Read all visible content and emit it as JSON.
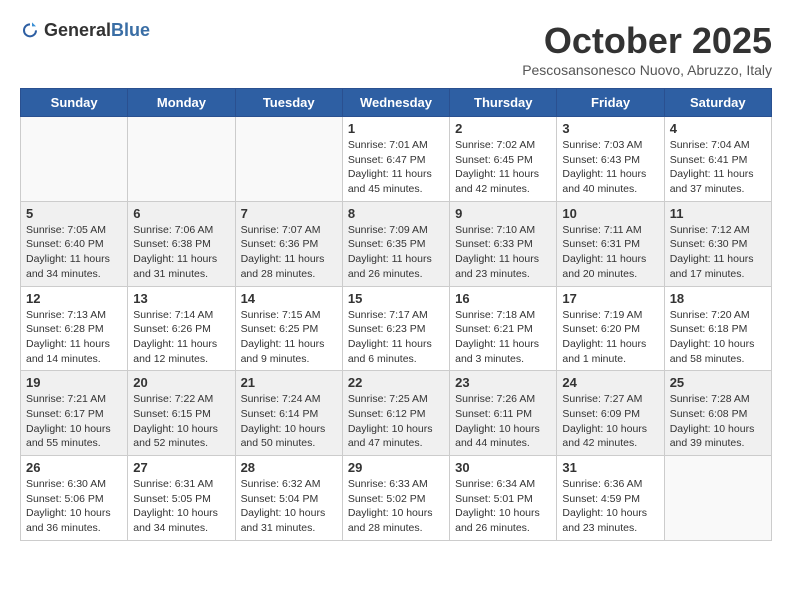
{
  "logo": {
    "general": "General",
    "blue": "Blue"
  },
  "title": "October 2025",
  "subtitle": "Pescosansonesco Nuovo, Abruzzo, Italy",
  "weekdays": [
    "Sunday",
    "Monday",
    "Tuesday",
    "Wednesday",
    "Thursday",
    "Friday",
    "Saturday"
  ],
  "weeks": [
    [
      {
        "day": "",
        "info": ""
      },
      {
        "day": "",
        "info": ""
      },
      {
        "day": "",
        "info": ""
      },
      {
        "day": "1",
        "info": "Sunrise: 7:01 AM\nSunset: 6:47 PM\nDaylight: 11 hours\nand 45 minutes."
      },
      {
        "day": "2",
        "info": "Sunrise: 7:02 AM\nSunset: 6:45 PM\nDaylight: 11 hours\nand 42 minutes."
      },
      {
        "day": "3",
        "info": "Sunrise: 7:03 AM\nSunset: 6:43 PM\nDaylight: 11 hours\nand 40 minutes."
      },
      {
        "day": "4",
        "info": "Sunrise: 7:04 AM\nSunset: 6:41 PM\nDaylight: 11 hours\nand 37 minutes."
      }
    ],
    [
      {
        "day": "5",
        "info": "Sunrise: 7:05 AM\nSunset: 6:40 PM\nDaylight: 11 hours\nand 34 minutes."
      },
      {
        "day": "6",
        "info": "Sunrise: 7:06 AM\nSunset: 6:38 PM\nDaylight: 11 hours\nand 31 minutes."
      },
      {
        "day": "7",
        "info": "Sunrise: 7:07 AM\nSunset: 6:36 PM\nDaylight: 11 hours\nand 28 minutes."
      },
      {
        "day": "8",
        "info": "Sunrise: 7:09 AM\nSunset: 6:35 PM\nDaylight: 11 hours\nand 26 minutes."
      },
      {
        "day": "9",
        "info": "Sunrise: 7:10 AM\nSunset: 6:33 PM\nDaylight: 11 hours\nand 23 minutes."
      },
      {
        "day": "10",
        "info": "Sunrise: 7:11 AM\nSunset: 6:31 PM\nDaylight: 11 hours\nand 20 minutes."
      },
      {
        "day": "11",
        "info": "Sunrise: 7:12 AM\nSunset: 6:30 PM\nDaylight: 11 hours\nand 17 minutes."
      }
    ],
    [
      {
        "day": "12",
        "info": "Sunrise: 7:13 AM\nSunset: 6:28 PM\nDaylight: 11 hours\nand 14 minutes."
      },
      {
        "day": "13",
        "info": "Sunrise: 7:14 AM\nSunset: 6:26 PM\nDaylight: 11 hours\nand 12 minutes."
      },
      {
        "day": "14",
        "info": "Sunrise: 7:15 AM\nSunset: 6:25 PM\nDaylight: 11 hours\nand 9 minutes."
      },
      {
        "day": "15",
        "info": "Sunrise: 7:17 AM\nSunset: 6:23 PM\nDaylight: 11 hours\nand 6 minutes."
      },
      {
        "day": "16",
        "info": "Sunrise: 7:18 AM\nSunset: 6:21 PM\nDaylight: 11 hours\nand 3 minutes."
      },
      {
        "day": "17",
        "info": "Sunrise: 7:19 AM\nSunset: 6:20 PM\nDaylight: 11 hours\nand 1 minute."
      },
      {
        "day": "18",
        "info": "Sunrise: 7:20 AM\nSunset: 6:18 PM\nDaylight: 10 hours\nand 58 minutes."
      }
    ],
    [
      {
        "day": "19",
        "info": "Sunrise: 7:21 AM\nSunset: 6:17 PM\nDaylight: 10 hours\nand 55 minutes."
      },
      {
        "day": "20",
        "info": "Sunrise: 7:22 AM\nSunset: 6:15 PM\nDaylight: 10 hours\nand 52 minutes."
      },
      {
        "day": "21",
        "info": "Sunrise: 7:24 AM\nSunset: 6:14 PM\nDaylight: 10 hours\nand 50 minutes."
      },
      {
        "day": "22",
        "info": "Sunrise: 7:25 AM\nSunset: 6:12 PM\nDaylight: 10 hours\nand 47 minutes."
      },
      {
        "day": "23",
        "info": "Sunrise: 7:26 AM\nSunset: 6:11 PM\nDaylight: 10 hours\nand 44 minutes."
      },
      {
        "day": "24",
        "info": "Sunrise: 7:27 AM\nSunset: 6:09 PM\nDaylight: 10 hours\nand 42 minutes."
      },
      {
        "day": "25",
        "info": "Sunrise: 7:28 AM\nSunset: 6:08 PM\nDaylight: 10 hours\nand 39 minutes."
      }
    ],
    [
      {
        "day": "26",
        "info": "Sunrise: 6:30 AM\nSunset: 5:06 PM\nDaylight: 10 hours\nand 36 minutes."
      },
      {
        "day": "27",
        "info": "Sunrise: 6:31 AM\nSunset: 5:05 PM\nDaylight: 10 hours\nand 34 minutes."
      },
      {
        "day": "28",
        "info": "Sunrise: 6:32 AM\nSunset: 5:04 PM\nDaylight: 10 hours\nand 31 minutes."
      },
      {
        "day": "29",
        "info": "Sunrise: 6:33 AM\nSunset: 5:02 PM\nDaylight: 10 hours\nand 28 minutes."
      },
      {
        "day": "30",
        "info": "Sunrise: 6:34 AM\nSunset: 5:01 PM\nDaylight: 10 hours\nand 26 minutes."
      },
      {
        "day": "31",
        "info": "Sunrise: 6:36 AM\nSunset: 4:59 PM\nDaylight: 10 hours\nand 23 minutes."
      },
      {
        "day": "",
        "info": ""
      }
    ]
  ]
}
